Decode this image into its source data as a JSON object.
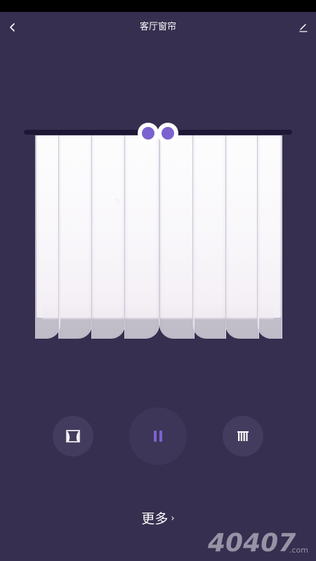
{
  "header": {
    "title": "客厅窗帘",
    "back_icon": "chevron-left-icon",
    "edit_icon": "pencil-icon"
  },
  "curtain": {
    "panel_count": 8,
    "knob_color": "#7b62d0",
    "rail_color": "#1e1735"
  },
  "controls": {
    "open_icon": "curtain-open-icon",
    "pause_icon": "pause-icon",
    "close_icon": "curtain-close-icon",
    "accent": "#7b62d0"
  },
  "more": {
    "label": "更多",
    "chevron": "›"
  },
  "watermark": {
    "text": "40407",
    "suffix": ".com"
  },
  "colors": {
    "background": "#362f4f",
    "button": "#443c5e"
  }
}
